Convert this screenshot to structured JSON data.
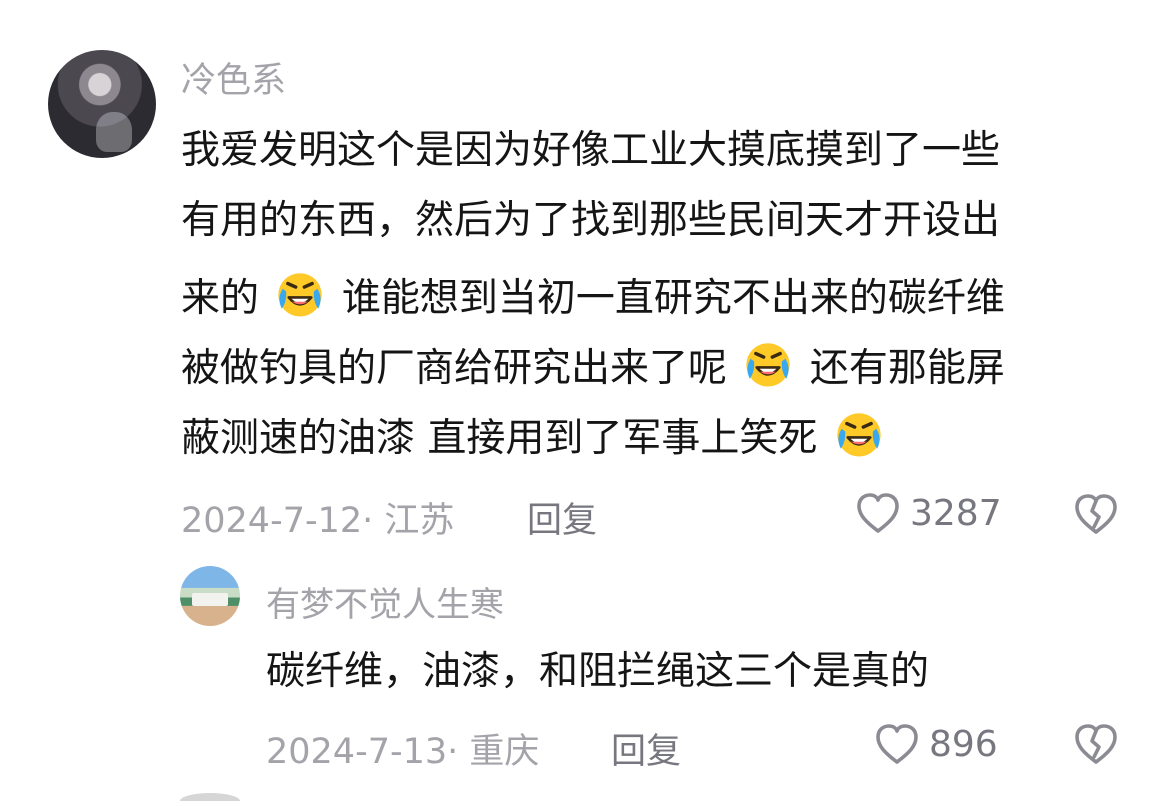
{
  "comment": {
    "username": "冷色系",
    "lines": [
      "我爱发明这个是因为好像工业大摸底摸到了一些",
      "有用的东西，然后为了找到那些民间天才开设出",
      [
        "来的",
        "谁能想到当初一直研究不出来的碳纤维"
      ],
      [
        "被做钓具的厂商给研究出来了呢",
        "还有那能屏"
      ],
      [
        "蔽测速的油漆 直接用到了军事上笑死"
      ]
    ],
    "date_location": "2024-7-12· 江苏",
    "reply_label": "回复",
    "likes": "3287"
  },
  "reply": {
    "username": "有梦不觉人生寒",
    "text": "碳纤维，油漆，和阻拦绳这三个是真的",
    "date_location": "2024-7-13· 重庆",
    "reply_label": "回复",
    "likes": "896"
  },
  "icons": {
    "emoji": "laughing-crying-emoji",
    "like": "heart-icon",
    "dislike": "broken-heart-icon"
  },
  "colors": {
    "primary_text": "#151515",
    "secondary_text": "#a3a3a9",
    "action_text": "#777780",
    "emoji_face": "#ffc928",
    "emoji_tear": "#39a8ef"
  }
}
